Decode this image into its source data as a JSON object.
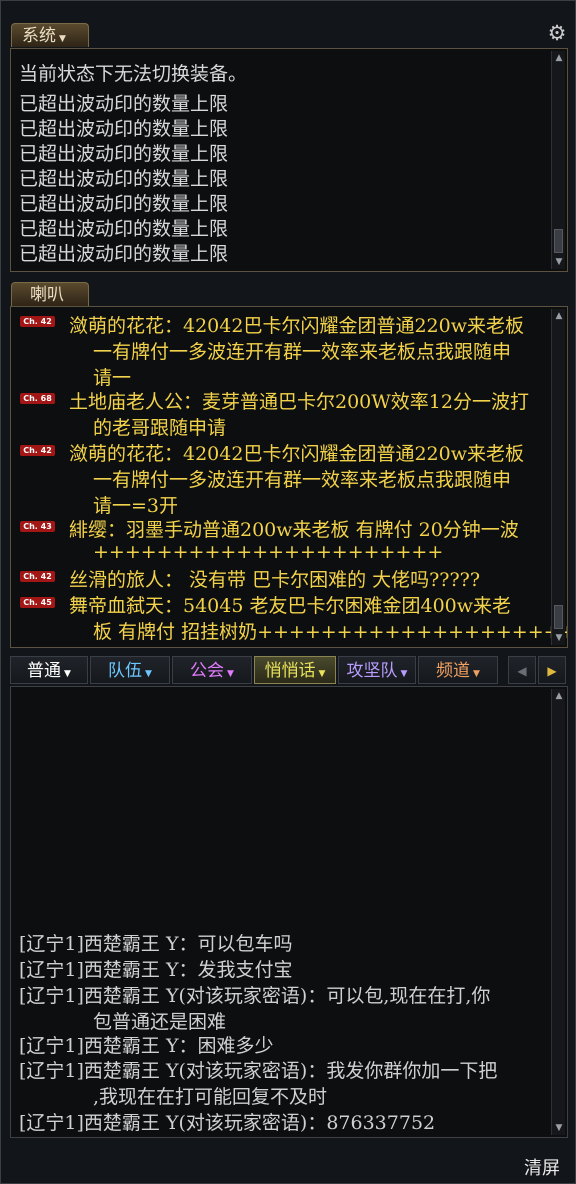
{
  "system": {
    "tab_label": "系统",
    "lines": [
      "当前状态下无法切换装备。",
      "已超出波动印的数量上限",
      "已超出波动印的数量上限",
      "已超出波动印的数量上限",
      "已超出波动印的数量上限",
      "已超出波动印的数量上限",
      "已超出波动印的数量上限",
      "已超出波动印的数量上限"
    ]
  },
  "trumpet": {
    "tab_label": "喇叭",
    "badges": [
      "Ch. 42",
      "Ch. 68",
      "Ch. 42",
      "Ch. 43",
      "Ch. 42",
      "Ch. 45"
    ],
    "lines": [
      "潋萌的花花：42042巴卡尔闪耀金团普通220w来老板",
      "一有牌付一多波连开有群一效率来老板点我跟随申",
      "请一",
      "土地庙老人公：麦芽普通巴卡尔200W效率12分一波打",
      "的老哥跟随申请",
      "潋萌的花花：42042巴卡尔闪耀金团普通220w来老板",
      "一有牌付一多波连开有群一效率来老板点我跟随申",
      "请一=3开",
      "緋缨：羽墨手动普通200w来老板 有牌付 20分钟一波",
      "++++++++++++++++++++++",
      "丝滑的旅人： 没有带 巴卡尔困难的  大佬吗?????",
      "舞帝血弑天：54045 老友巴卡尔困难金团400w来老",
      "板 有牌付 招挂树奶++++++++++++++++++++++"
    ]
  },
  "chat_tabs": [
    {
      "label": "普通",
      "color": "#ffffff"
    },
    {
      "label": "队伍",
      "color": "#6cc8ff"
    },
    {
      "label": "公会",
      "color": "#e27bff"
    },
    {
      "label": "悄悄话",
      "color": "#e8e35a"
    },
    {
      "label": "攻坚队",
      "color": "#b99cff"
    },
    {
      "label": "频道",
      "color": "#f0a060"
    }
  ],
  "chat": {
    "lines": [
      "[辽宁1]西楚霸王 Y：可以包车吗",
      "[辽宁1]西楚霸王 Y：发我支付宝",
      "[辽宁1]西楚霸王 Y(对该玩家密语)：可以包,现在在打,你",
      "包普通还是困难",
      "[辽宁1]西楚霸王 Y：困难多少",
      "[辽宁1]西楚霸王 Y(对该玩家密语)：我发你群你加一下把",
      ",我现在在打可能回复不及时",
      "[辽宁1]西楚霸王 Y(对该玩家密语)：876337752"
    ],
    "clear_label": "清屏"
  },
  "icons": [
    "gear-icon",
    "chevron-down-icon",
    "scroll-up-icon",
    "scroll-down-icon",
    "arrow-left-icon",
    "arrow-right-icon"
  ]
}
